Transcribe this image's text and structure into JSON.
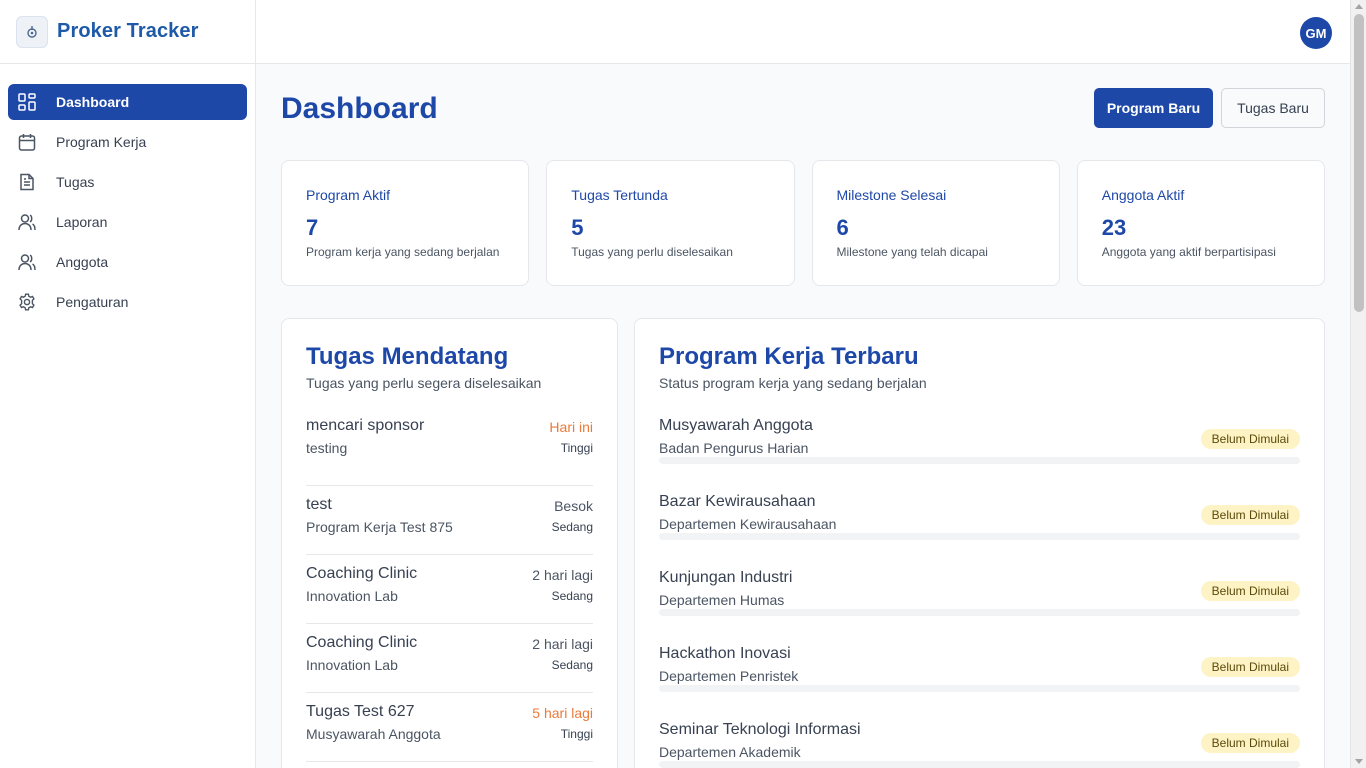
{
  "app": {
    "title": "Proker Tracker",
    "user_initials": "GM"
  },
  "sidebar": {
    "items": [
      {
        "label": "Dashboard",
        "icon": "dashboard-icon",
        "active": true
      },
      {
        "label": "Program Kerja",
        "icon": "calendar-icon",
        "active": false
      },
      {
        "label": "Tugas",
        "icon": "document-icon",
        "active": false
      },
      {
        "label": "Laporan",
        "icon": "users-icon",
        "active": false
      },
      {
        "label": "Anggota",
        "icon": "users-icon",
        "active": false
      },
      {
        "label": "Pengaturan",
        "icon": "gear-icon",
        "active": false
      }
    ]
  },
  "page": {
    "title": "Dashboard",
    "btn_new_program": "Program Baru",
    "btn_new_task": "Tugas Baru"
  },
  "stats": [
    {
      "title": "Program Aktif",
      "value": "7",
      "desc": "Program kerja yang sedang berjalan"
    },
    {
      "title": "Tugas Tertunda",
      "value": "5",
      "desc": "Tugas yang perlu diselesaikan"
    },
    {
      "title": "Milestone Selesai",
      "value": "6",
      "desc": "Milestone yang telah dicapai"
    },
    {
      "title": "Anggota Aktif",
      "value": "23",
      "desc": "Anggota yang aktif berpartisipasi"
    }
  ],
  "upcoming": {
    "title": "Tugas Mendatang",
    "subtitle": "Tugas yang perlu segera diselesaikan",
    "tasks": [
      {
        "name": "mencari sponsor",
        "program": "testing",
        "due": "Hari ini",
        "priority": "Tinggi",
        "urgent": true
      },
      {
        "name": "test",
        "program": "Program Kerja Test 875",
        "due": "Besok",
        "priority": "Sedang",
        "urgent": false
      },
      {
        "name": "Coaching Clinic",
        "program": "Innovation Lab",
        "due": "2 hari lagi",
        "priority": "Sedang",
        "urgent": false
      },
      {
        "name": "Coaching Clinic",
        "program": "Innovation Lab",
        "due": "2 hari lagi",
        "priority": "Sedang",
        "urgent": false
      },
      {
        "name": "Tugas Test 627",
        "program": "Musyawarah Anggota",
        "due": "5 hari lagi",
        "priority": "Tinggi",
        "urgent": true
      }
    ]
  },
  "recent": {
    "title": "Program Kerja Terbaru",
    "subtitle": "Status program kerja yang sedang berjalan",
    "programs": [
      {
        "name": "Musyawarah Anggota",
        "dept": "Badan Pengurus Harian",
        "status": "Belum Dimulai",
        "progress": 0
      },
      {
        "name": "Bazar Kewirausahaan",
        "dept": "Departemen Kewirausahaan",
        "status": "Belum Dimulai",
        "progress": 0
      },
      {
        "name": "Kunjungan Industri",
        "dept": "Departemen Humas",
        "status": "Belum Dimulai",
        "progress": 0
      },
      {
        "name": "Hackathon Inovasi",
        "dept": "Departemen Penristek",
        "status": "Belum Dimulai",
        "progress": 0
      },
      {
        "name": "Seminar Teknologi Informasi",
        "dept": "Departemen Akademik",
        "status": "Belum Dimulai",
        "progress": 0
      }
    ]
  },
  "colors": {
    "primary": "#1e48a8",
    "urgent": "#ea7a3a",
    "badge_bg": "#fdf3c4"
  }
}
